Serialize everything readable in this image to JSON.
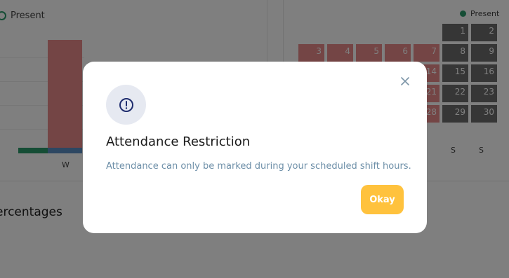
{
  "background": {
    "left_legend": "Present",
    "right_legend": "Present",
    "chart_x_label": "W",
    "section_title": "ercentages",
    "calendar": {
      "row1": [
        "",
        "",
        "",
        "",
        "",
        "1",
        "2"
      ],
      "row2": [
        "3",
        "4",
        "5",
        "6",
        "7",
        "8",
        "9"
      ],
      "row3": [
        "",
        "",
        "",
        "",
        "14",
        "15",
        "16"
      ],
      "row4": [
        "",
        "",
        "",
        "",
        "21",
        "22",
        "23"
      ],
      "row5": [
        "",
        "",
        "",
        "",
        "28",
        "29",
        "30"
      ],
      "day_headers": [
        "S",
        "S"
      ]
    }
  },
  "modal": {
    "title": "Attendance Restriction",
    "message": "Attendance can only be marked during your scheduled shift hours.",
    "ok_label": "Okay"
  }
}
